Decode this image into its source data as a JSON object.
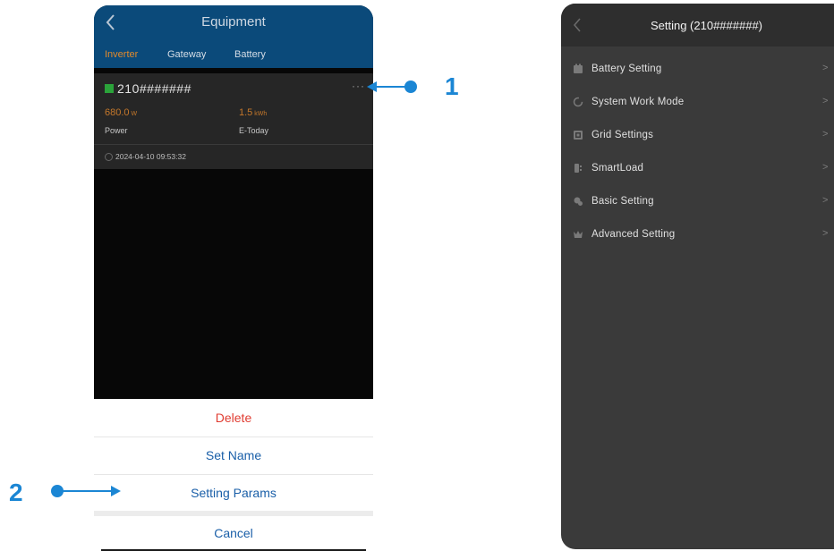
{
  "left_screen": {
    "title": "Equipment",
    "tabs": [
      {
        "label": "Inverter",
        "active": true
      },
      {
        "label": "Gateway",
        "active": false
      },
      {
        "label": "Battery",
        "active": false
      }
    ],
    "device": {
      "serial": "210#######",
      "more": "···",
      "power_value": "680.0",
      "power_unit": "W",
      "power_label": "Power",
      "etoday_value": "1.5",
      "etoday_unit": "kWh",
      "etoday_label": "E-Today",
      "timestamp": "2024-04-10 09:53:32"
    },
    "action_sheet": {
      "delete": "Delete",
      "set_name": "Set Name",
      "setting_params": "Setting Params",
      "cancel": "Cancel"
    }
  },
  "annotations": {
    "callout_1": "1",
    "callout_2": "2"
  },
  "right_screen": {
    "title": "Setting (210#######)",
    "menu_items": [
      {
        "label": "Battery Setting",
        "icon": "battery-icon"
      },
      {
        "label": "System Work Mode",
        "icon": "refresh-icon"
      },
      {
        "label": "Grid Settings",
        "icon": "grid-icon"
      },
      {
        "label": "SmartLoad",
        "icon": "smartload-icon"
      },
      {
        "label": "Basic Setting",
        "icon": "settings-icon"
      },
      {
        "label": "Advanced Setting",
        "icon": "crown-icon"
      }
    ]
  },
  "colors": {
    "header_blue": "#0b4a7a",
    "active_tab": "#e28a2b",
    "value_orange": "#c5782b",
    "delete_red": "#e03c31",
    "sheet_blue": "#1a5fa8",
    "annotation_blue": "#1b86d4"
  }
}
